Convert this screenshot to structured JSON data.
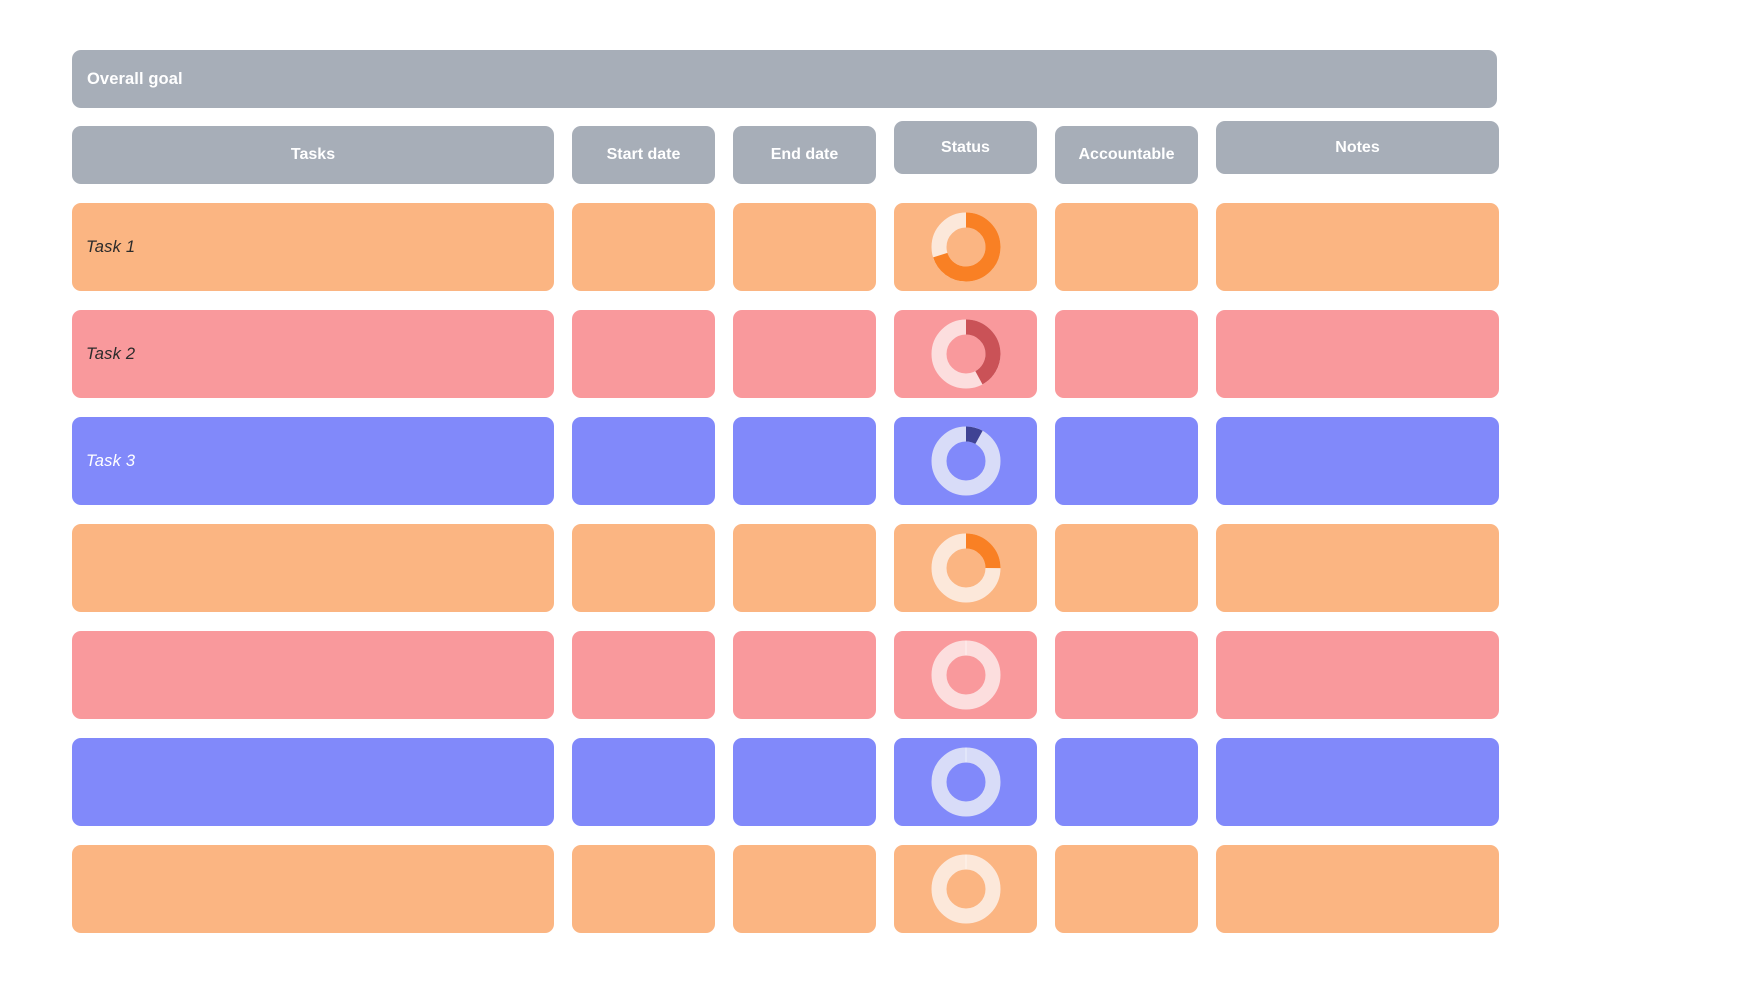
{
  "banner": {
    "label": "Overall goal"
  },
  "table": {
    "headers": [
      {
        "label": "Tasks",
        "size": "tall"
      },
      {
        "label": "Start date",
        "size": "tall"
      },
      {
        "label": "End date",
        "size": "tall"
      },
      {
        "label": "Status",
        "size": "short"
      },
      {
        "label": "Accountable",
        "size": "tall"
      },
      {
        "label": "Notes",
        "size": "short"
      }
    ],
    "rows": [
      {
        "task": "Task 1",
        "start_date": "",
        "end_date": "",
        "accountable": "",
        "notes": "",
        "palette": "orange",
        "text": "dark",
        "status_percent": 70
      },
      {
        "task": "Task 2",
        "start_date": "",
        "end_date": "",
        "accountable": "",
        "notes": "",
        "palette": "pink",
        "text": "dark",
        "status_percent": 42
      },
      {
        "task": "Task 3",
        "start_date": "",
        "end_date": "",
        "accountable": "",
        "notes": "",
        "palette": "blue",
        "text": "light",
        "status_percent": 8
      },
      {
        "task": "",
        "start_date": "",
        "end_date": "",
        "accountable": "",
        "notes": "",
        "palette": "orange",
        "text": "dark",
        "status_percent": 25
      },
      {
        "task": "",
        "start_date": "",
        "end_date": "",
        "accountable": "",
        "notes": "",
        "palette": "pink",
        "text": "dark",
        "status_percent": 0
      },
      {
        "task": "",
        "start_date": "",
        "end_date": "",
        "accountable": "",
        "notes": "",
        "palette": "blue",
        "text": "light",
        "status_percent": 0
      },
      {
        "task": "",
        "start_date": "",
        "end_date": "",
        "accountable": "",
        "notes": "",
        "palette": "orange",
        "text": "dark",
        "status_percent": 0
      }
    ]
  },
  "colors": {
    "header_gray": "#a7aeb8",
    "row_orange": "#fbb582",
    "row_pink": "#f9999c",
    "row_blue": "#8189fa",
    "donut_orange_fill": "#f98024",
    "donut_orange_track": "#fce8da",
    "donut_pink_fill": "#ca5257",
    "donut_pink_track": "#fcdede",
    "donut_blue_fill": "#3f4394",
    "donut_blue_track": "#d8dcf8",
    "page_background": "#ffffff"
  },
  "chart_data": [
    {
      "type": "pie",
      "title": "Status Task 1",
      "labels": [
        "Complete",
        "Remaining"
      ],
      "values": [
        70,
        30
      ],
      "colors": [
        "#f98024",
        "#fce8da"
      ],
      "donut": true
    },
    {
      "type": "pie",
      "title": "Status Task 2",
      "labels": [
        "Complete",
        "Remaining"
      ],
      "values": [
        42,
        58
      ],
      "colors": [
        "#ca5257",
        "#fcdede"
      ],
      "donut": true
    },
    {
      "type": "pie",
      "title": "Status Task 3",
      "labels": [
        "Complete",
        "Remaining"
      ],
      "values": [
        8,
        92
      ],
      "colors": [
        "#3f4394",
        "#d8dcf8"
      ],
      "donut": true
    },
    {
      "type": "pie",
      "title": "Status row 4",
      "labels": [
        "Complete",
        "Remaining"
      ],
      "values": [
        25,
        75
      ],
      "colors": [
        "#f98024",
        "#fce8da"
      ],
      "donut": true
    },
    {
      "type": "pie",
      "title": "Status row 5",
      "labels": [
        "Complete",
        "Remaining"
      ],
      "values": [
        0,
        100
      ],
      "colors": [
        "#ca5257",
        "#fcdede"
      ],
      "donut": true
    },
    {
      "type": "pie",
      "title": "Status row 6",
      "labels": [
        "Complete",
        "Remaining"
      ],
      "values": [
        0,
        100
      ],
      "colors": [
        "#3f4394",
        "#d8dcf8"
      ],
      "donut": true
    },
    {
      "type": "pie",
      "title": "Status row 7",
      "labels": [
        "Complete",
        "Remaining"
      ],
      "values": [
        0,
        100
      ],
      "colors": [
        "#f98024",
        "#fce8da"
      ],
      "donut": true
    }
  ]
}
